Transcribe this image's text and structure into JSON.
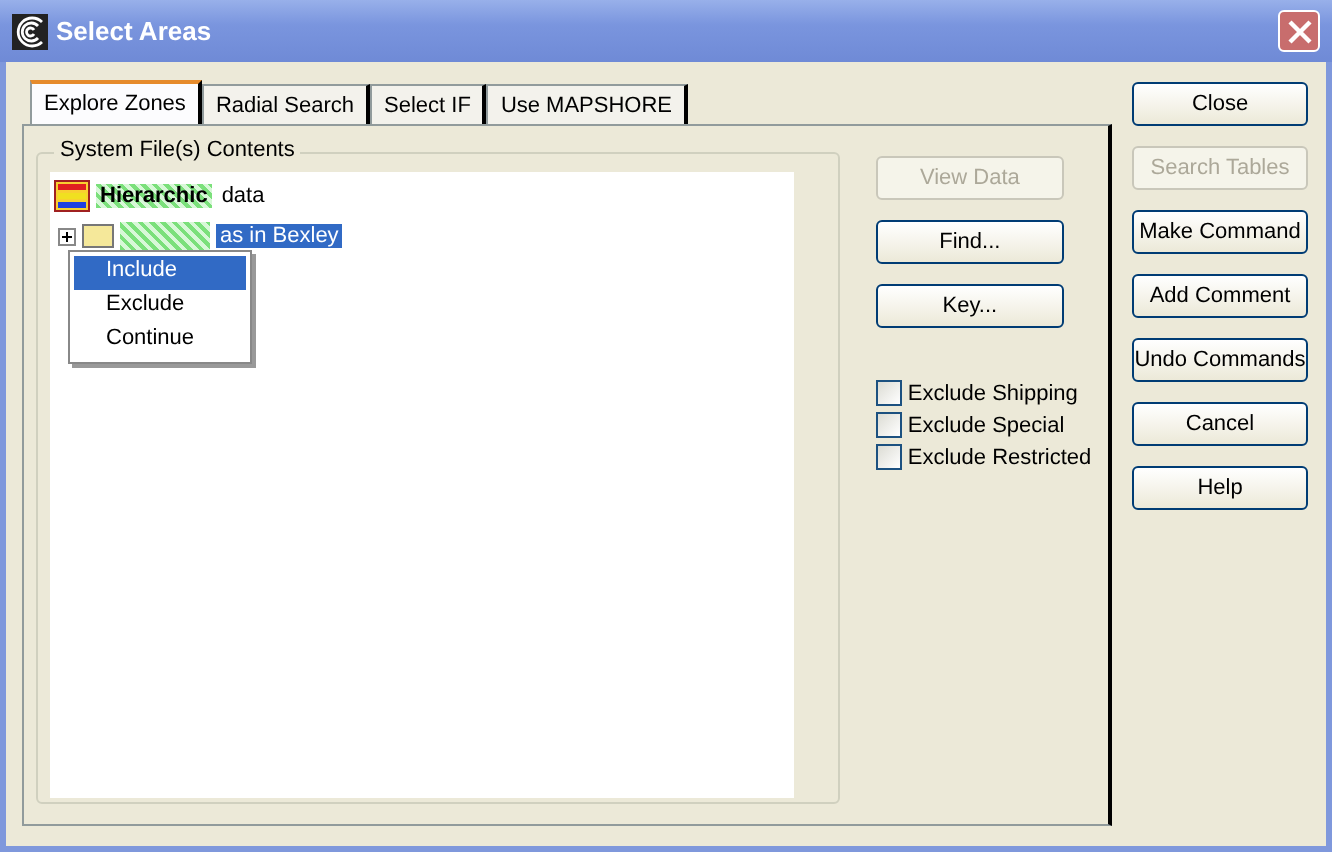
{
  "window": {
    "title": "Select Areas"
  },
  "tabs": [
    {
      "label": "Explore Zones",
      "selected": true
    },
    {
      "label": "Radial Search",
      "selected": false
    },
    {
      "label": "Select IF",
      "selected": false
    },
    {
      "label": "Use MAPSHORE",
      "selected": false
    }
  ],
  "group": {
    "title": "System File(s) Contents"
  },
  "tree": [
    {
      "tag": "Hierarchic",
      "label": "data",
      "selected": false,
      "children": [
        {
          "label": "as in Bexley",
          "selected": true,
          "expanded": false
        }
      ]
    }
  ],
  "context_menu": [
    {
      "label": "Include",
      "selected": true
    },
    {
      "label": "Exclude",
      "selected": false
    },
    {
      "label": "Continue",
      "selected": false
    }
  ],
  "panel_buttons": [
    {
      "label": "View Data",
      "disabled": true
    },
    {
      "label": "Find...",
      "disabled": false
    },
    {
      "label": "Key...",
      "disabled": false
    }
  ],
  "checkboxes": [
    {
      "label": "Exclude Shipping",
      "checked": false
    },
    {
      "label": "Exclude Special",
      "checked": false
    },
    {
      "label": "Exclude Restricted",
      "checked": false
    }
  ],
  "side_buttons": [
    {
      "label": "Close",
      "disabled": false
    },
    {
      "label": "Search Tables",
      "disabled": true
    },
    {
      "label": "Make Command",
      "disabled": false
    },
    {
      "label": "Add Comment",
      "disabled": false
    },
    {
      "label": "Undo Commands",
      "disabled": false
    },
    {
      "label": "Cancel",
      "disabled": false
    },
    {
      "label": "Help",
      "disabled": false
    }
  ]
}
